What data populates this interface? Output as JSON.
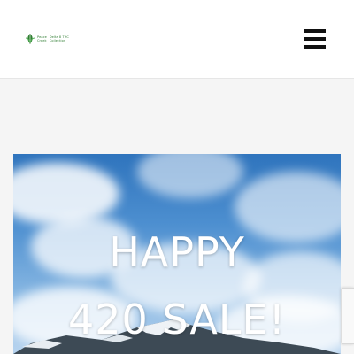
{
  "header": {
    "logo": {
      "mark_text": "The",
      "line1": "Peace",
      "line2": "Creek",
      "tagline1": "Delta 8 THC",
      "tagline2": "Collection"
    },
    "menu_icon": "hamburger-menu-icon"
  },
  "hero": {
    "line1": "HAPPY",
    "line2": "420 SALE!"
  },
  "badge": {
    "icon": "recaptcha-icon"
  },
  "colors": {
    "sky_top": "#2f74bd",
    "sky_bottom": "#b8d4ef",
    "logo_green": "#2f7d32",
    "menu_icon": "#111111",
    "header_bg": "#ffffff",
    "page_bg": "#f5f5f5"
  }
}
